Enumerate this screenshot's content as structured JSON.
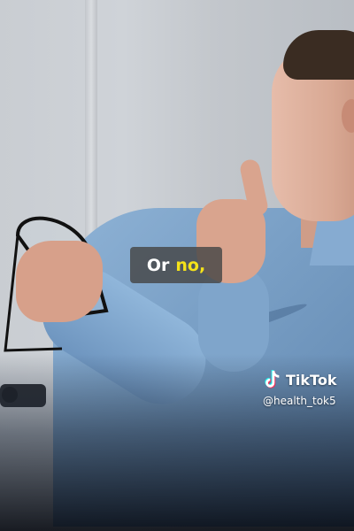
{
  "caption": {
    "word1": "Or",
    "word2": "no,"
  },
  "watermark": {
    "brand": "TikTok",
    "handle": "@health_tok5",
    "icon": "tiktok-logo-icon"
  },
  "colors": {
    "caption_bg": "#464646",
    "caption_text": "#ffffff",
    "caption_highlight": "#f5e21a",
    "shirt": "#7aa0c6"
  }
}
